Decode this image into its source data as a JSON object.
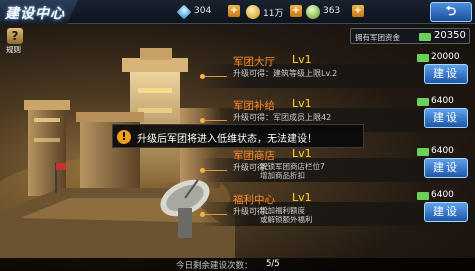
{
  "header": {
    "title": "建设中心",
    "resources": [
      {
        "icon": "diamond-icon",
        "value": "304",
        "color": "#7ad0ff"
      },
      {
        "icon": "gold-coin-icon",
        "value": "11万",
        "color": "#f2c23a"
      },
      {
        "icon": "stamina-icon",
        "value": "363",
        "color": "#9ad85a"
      }
    ],
    "plus_label": "+",
    "back_label": "⮌"
  },
  "rule": {
    "label": "规则",
    "icon_glyph": "?"
  },
  "funds": {
    "label": "拥有军团资金",
    "value": "20350"
  },
  "rows": [
    {
      "name": "军团大厅",
      "level": "Lv1",
      "desc": "升级可得：建筑等级上限Lv.2",
      "cost": "20000",
      "button": "建设"
    },
    {
      "name": "军团补给",
      "level": "Lv1",
      "desc": "升级可得：军团成员上限42",
      "cost": "6400",
      "button": "建设"
    },
    {
      "name": "军团商店",
      "level": "Lv1",
      "desc_prefix": "升级可得：",
      "desc_lines": [
        "解锁军团商店栏位7",
        "增加商品折扣"
      ],
      "cost": "6400",
      "button": "建设"
    },
    {
      "name": "福利中心",
      "level": "Lv1",
      "desc_prefix": "升级可得：",
      "desc_lines": [
        "增加福利额度",
        "或解锁额外福利"
      ],
      "cost": "6400",
      "button": "建设"
    }
  ],
  "popup": {
    "warning_glyph": "!",
    "message": "升级后军团将进入低维状态，无法建设！"
  },
  "footer": {
    "label": "今日剩余建设次数：",
    "value": "5/5"
  }
}
